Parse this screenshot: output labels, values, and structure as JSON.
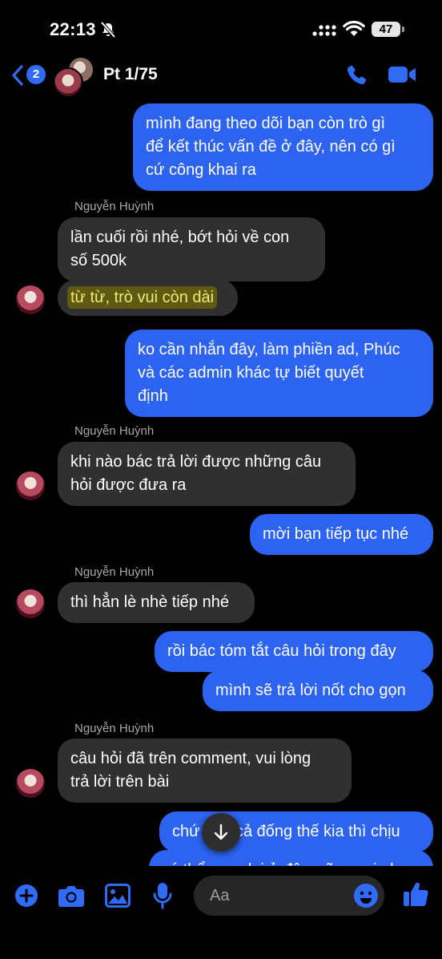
{
  "status_bar": {
    "time": "22:13",
    "battery": "47"
  },
  "header": {
    "back_count": "2",
    "title": "Pt 1/75"
  },
  "messages": {
    "m1": [
      "mình đang theo dõi bạn còn trò gì",
      "để kết thúc vấn đề ở đây, nên có gì",
      "cứ công khai ra"
    ],
    "sender1": "Nguyễn Huỳnh",
    "m2": [
      "lần cuối rồi nhé, bớt hỏi về con",
      "số 500k"
    ],
    "m3": "từ từ, trò vui còn dài",
    "m4": [
      "ko cần nhắn đây, làm phiền ad, Phúc",
      "và các admin khác tự biết quyết",
      "định"
    ],
    "sender2": "Nguyễn Huỳnh",
    "m5": [
      "khi nào bác trả lời được những câu",
      "hỏi được đưa ra"
    ],
    "m6": "mời bạn tiếp tục nhé",
    "sender3": "Nguyễn Huỳnh",
    "m7": "thì hẳn lè nhè tiếp nhé",
    "m8": "rồi bác tóm tắt câu hỏi trong đây",
    "m9": "mình sẽ trả lời nốt cho gọn",
    "sender4": "Nguyễn Huỳnh",
    "m10": [
      "câu hỏi đã trên comment, vui lòng",
      "trả lời trên bài"
    ],
    "m11": "chứ        cả đống thế kia thì chịu",
    "m12": "có thể copy lại ở đây, cũng coi như để"
  },
  "composer": {
    "placeholder": "Aa"
  },
  "colors": {
    "accent": "#2f6bf5",
    "outgoing_bubble": "#2c63f0",
    "incoming_bubble": "#303030",
    "highlight": "#5e5a12"
  }
}
